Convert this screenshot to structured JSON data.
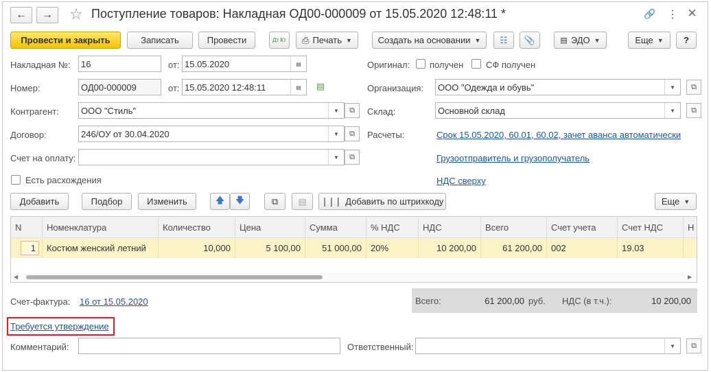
{
  "window": {
    "title": "Поступление товаров: Накладная ОД00-000009 от 15.05.2020 12:48:11 *",
    "star": "☆",
    "link_icon": "🔗",
    "more_icon": "⋮",
    "close_icon": "×"
  },
  "toolbar": {
    "post_close": "Провести и закрыть",
    "save": "Записать",
    "post": "Провести",
    "dt_kt": "Дт Кт",
    "print": "Печать",
    "create_based": "Создать на основании",
    "edo": "ЭДО",
    "more": "Еще",
    "help": "?"
  },
  "form": {
    "invoice_no_label": "Накладная №:",
    "invoice_no": "16",
    "from_label": "от:",
    "invoice_date": "15.05.2020",
    "number_label": "Номер:",
    "number": "ОД00-000009",
    "doc_datetime": "15.05.2020 12:48:11",
    "original_label": "Оригинал:",
    "received_label": "получен",
    "sf_received_label": "СФ получен",
    "org_label": "Организация:",
    "org": "ООО \"Одежда и обувь\"",
    "counterparty_label": "Контрагент:",
    "counterparty": "ООО \"Стиль\"",
    "warehouse_label": "Склад:",
    "warehouse": "Основной склад",
    "contract_label": "Договор:",
    "contract": "246/ОУ от 30.04.2020",
    "settlements_label": "Расчеты:",
    "settlements_link": "Срок 15.05.2020, 60.01, 60.02, зачет аванса автоматически",
    "payment_account_label": "Счет на оплату:",
    "payment_account": "",
    "shipper_link": "Грузоотправитель и грузополучатель",
    "discrepancy_label": "Есть расхождения",
    "vat_link": "НДС сверху"
  },
  "table_toolbar": {
    "add": "Добавить",
    "selection": "Подбор",
    "change": "Изменить",
    "add_barcode": "Добавить по штрихкоду",
    "more": "Еще"
  },
  "table": {
    "headers": [
      "N",
      "Номенклатура",
      "Количество",
      "Цена",
      "Сумма",
      "% НДС",
      "НДС",
      "Всего",
      "Счет учета",
      "Счет НДС",
      "Н"
    ],
    "rows": [
      {
        "n": "1",
        "item": "Костюм женский летний",
        "qty": "10,000",
        "price": "5 100,00",
        "sum": "51 000,00",
        "vat_rate": "20%",
        "vat": "10 200,00",
        "total": "61 200,00",
        "account": "002",
        "vat_account": "19.03"
      }
    ],
    "scroll_fraction": 0.45
  },
  "footer": {
    "invoice_label": "Счет-фактура:",
    "invoice_link": "16 от 15.05.2020",
    "total_label": "Всего:",
    "total_value": "61 200,00",
    "currency": "руб.",
    "vat_label": "НДС (в т.ч.):",
    "vat_value": "10 200,00",
    "approval_link": "Требуется утверждение",
    "comment_label": "Комментарий:",
    "comment": "",
    "responsible_label": "Ответственный:",
    "responsible": ""
  },
  "colors": {
    "primary_button": "#f2c300",
    "row_highlight": "#fdf3c9",
    "link": "#1c55a8",
    "highlight_box": "#e02020"
  }
}
